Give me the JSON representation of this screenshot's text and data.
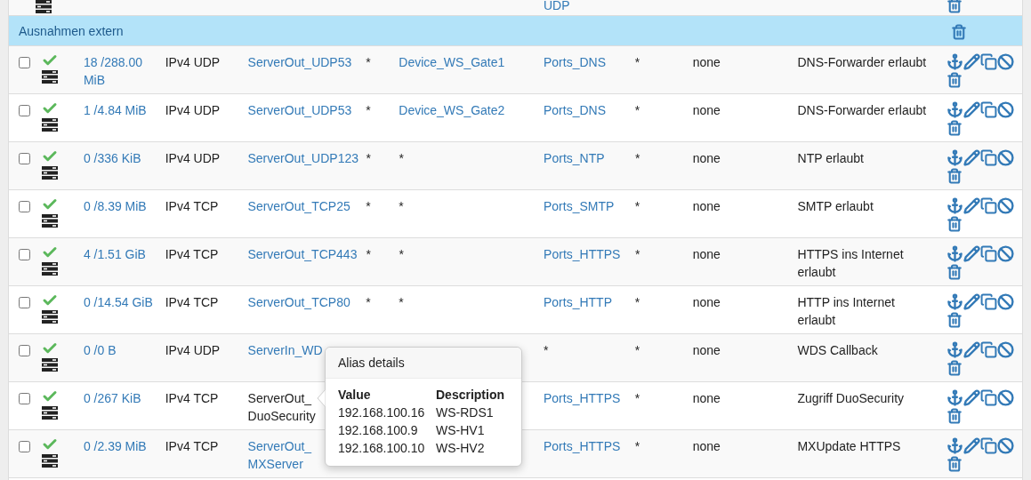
{
  "top_row": {
    "destination_port": "UDP"
  },
  "group": {
    "title": "Ausnahmen extern"
  },
  "rules": [
    {
      "checked": false,
      "states": "18 /288.00 MiB",
      "protocol": "IPv4 UDP",
      "source": "ServerOut_UDP53",
      "source_highlighted": false,
      "source_port": "*",
      "destination": "Device_WS_Gate1",
      "destination_port": "Ports_DNS",
      "gateway": "*",
      "queue": "none",
      "description": "DNS-Forwarder erlaubt"
    },
    {
      "checked": false,
      "states": "1 /4.84 MiB",
      "protocol": "IPv4 UDP",
      "source": "ServerOut_UDP53",
      "source_highlighted": false,
      "source_port": "*",
      "destination": "Device_WS_Gate2",
      "destination_port": "Ports_DNS",
      "gateway": "*",
      "queue": "none",
      "description": "DNS-Forwarder erlaubt"
    },
    {
      "checked": false,
      "states": "0 /336 KiB",
      "protocol": "IPv4 UDP",
      "source": "ServerOut_UDP123",
      "source_highlighted": false,
      "source_port": "*",
      "destination": "*",
      "destination_port": "Ports_NTP",
      "gateway": "*",
      "queue": "none",
      "description": "NTP erlaubt"
    },
    {
      "checked": false,
      "states": "0 /8.39 MiB",
      "protocol": "IPv4 TCP",
      "source": "ServerOut_TCP25",
      "source_highlighted": false,
      "source_port": "*",
      "destination": "*",
      "destination_port": "Ports_SMTP",
      "gateway": "*",
      "queue": "none",
      "description": "SMTP erlaubt"
    },
    {
      "checked": false,
      "states": "4 /1.51 GiB",
      "protocol": "IPv4 TCP",
      "source": "ServerOut_TCP443",
      "source_highlighted": false,
      "source_port": "*",
      "destination": "*",
      "destination_port": "Ports_HTTPS",
      "gateway": "*",
      "queue": "none",
      "description": "HTTPS ins Internet erlaubt"
    },
    {
      "checked": false,
      "states": "0 /14.54 GiB",
      "protocol": "IPv4 TCP",
      "source": "ServerOut_TCP80",
      "source_highlighted": false,
      "source_port": "*",
      "destination": "*",
      "destination_port": "Ports_HTTP",
      "gateway": "*",
      "queue": "none",
      "description": "HTTP ins Internet erlaubt"
    },
    {
      "checked": false,
      "states": "0 /0 B",
      "protocol": "IPv4 UDP",
      "source": "ServerIn_WD",
      "source_highlighted": false,
      "destination_port": "*",
      "gateway": "*",
      "queue": "none",
      "description": "WDS Callback"
    },
    {
      "checked": false,
      "states": "0 /267 KiB",
      "protocol": "IPv4 TCP",
      "source": "ServerOut_ DuoSecurity",
      "source_highlighted": true,
      "destination_port": "Ports_HTTPS",
      "gateway": "*",
      "queue": "none",
      "description": "Zugriff DuoSecurity"
    },
    {
      "checked": false,
      "states": "0 /2.39 MiB",
      "protocol": "IPv4 TCP",
      "source": "ServerOut_ MXServer",
      "source_highlighted": false,
      "destination_port": "Ports_HTTPS",
      "gateway": "*",
      "queue": "none",
      "description": "MXUpdate HTTPS"
    }
  ],
  "popover": {
    "title": "Alias details",
    "columns": [
      "Value",
      "Description"
    ],
    "rows": [
      [
        "192.168.100.16",
        "WS-RDS1"
      ],
      [
        "192.168.100.9",
        "WS-HV1"
      ],
      [
        "192.168.100.10",
        "WS-HV2"
      ]
    ]
  }
}
